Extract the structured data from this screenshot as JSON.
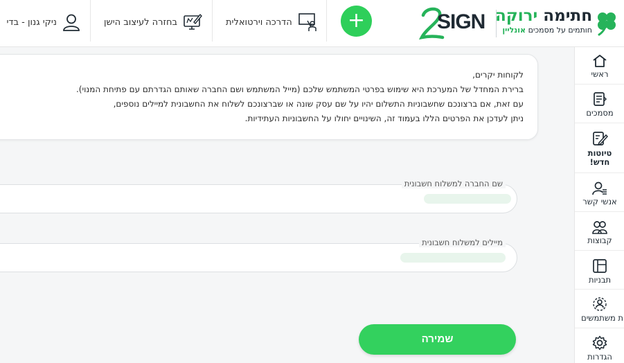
{
  "header": {
    "logo_2sign_digit": "2",
    "logo_2sign_word": "SIGN",
    "brand_main_dark": "חתימה",
    "brand_main_green": "ירוקה",
    "brand_sub_text": "חותמים על מסמכים",
    "brand_sub_green": "אונליין",
    "virtual_guide_label": "הדרכה וירטואלית",
    "old_design_label": "בחזרה לעיצוב הישן",
    "user_name": "ניקי גנון - בדי",
    "add_symbol": "+"
  },
  "sidebar": {
    "items": [
      {
        "label": "ראשי",
        "icon": "home-icon"
      },
      {
        "label": "מסמכים",
        "icon": "documents-icon"
      },
      {
        "label": "טיוטות",
        "label2": "חדש!",
        "icon": "drafts-icon"
      },
      {
        "label": "אנשי קשר",
        "icon": "contacts-icon"
      },
      {
        "label": "קבוצות",
        "icon": "groups-icon"
      },
      {
        "label": "תבניות",
        "icon": "templates-icon"
      },
      {
        "label": "ת משתמשים",
        "icon": "users-management-icon"
      },
      {
        "label": "הגדרות",
        "icon": "settings-icon"
      }
    ]
  },
  "notice": {
    "line1": "לקוחות יקרים,",
    "line2": "ברירת המחדל של המערכת היא שימוש בפרטי המשתמש שלכם (מייל המשתמש ושם החברה שאותם הגדרתם עם פתיחת המנוי).",
    "line3": "עם זאת, אם ברצונכם שחשבוניות התשלום יהיו על שם עסק שונה או שברצונכם לשלוח את החשבונית למיילים נוספים,",
    "line4": "ניתן לעדכן את הפרטים הללו בעמוד זה, השינויים יחולו על החשבוניות העתידיות."
  },
  "form": {
    "company_label": "שם החברה למשלוח חשבונית",
    "company_value": "",
    "emails_label": "מיילים למשלוח חשבונית",
    "emails_value": ""
  },
  "actions": {
    "save_label": "שמירה"
  },
  "colors": {
    "accent_green": "#2ecf5a",
    "brand_green": "#26b35a",
    "dark_text": "#1f2a33"
  }
}
